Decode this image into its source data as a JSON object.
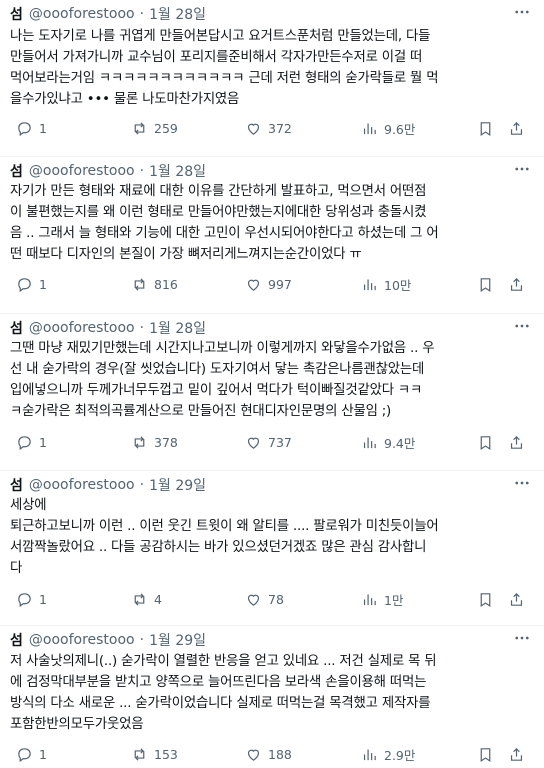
{
  "tweets": [
    {
      "name": "섬",
      "handle": "@oooforestooo",
      "date": "1월 28일",
      "text": "나는 도자기로 나를 귀엽게 만들어본답시고 요거트스푼처럼 만들었는데, 다들\n만들어서 가져가니까 교수님이 포리지를준비해서 각자가만든수저로 이걸 떠\n먹어보라는거임 ㅋㅋㅋㅋㅋㅋㅋㅋㅋㅋㅋㅋ 근데 저런 형태의 숟가락들로 뭘 먹\n을수가있냐고 ••• 물론 나도마찬가지였음",
      "replies": "1",
      "retweets": "259",
      "likes": "372",
      "views": "9.6만"
    },
    {
      "name": "섬",
      "handle": "@oooforestooo",
      "date": "1월 28일",
      "text": "자기가 만든 형태와 재료에 대한 이유를 간단하게 발표하고, 먹으면서 어떤점\n이 불편했는지를 왜 이런 형태로 만들어야만했는지에대한 당위성과 충돌시켰\n음 .. 그래서 늘 형태와 기능에 대한 고민이 우선시되어야한다고 하셨는데 그 어\n떤 때보다 디자인의 본질이 가장 뼈저리게느껴지는순간이었다 ㅠ",
      "replies": "1",
      "retweets": "816",
      "likes": "997",
      "views": "10만"
    },
    {
      "name": "섬",
      "handle": "@oooforestooo",
      "date": "1월 28일",
      "text": "그땐 마냥 재밌기만했는데 시간지나고보니까 이렇게까지 와닿을수가없음 .. 우\n선 내 숟가락의 경우(잘 씻었습니다) 도자기여서 닿는 촉감은나름괜찮았는데\n입에넣으니까 두께가너무두껍고 밑이 깊어서 먹다가 턱이빠질것같았다 ㅋㅋ\nㅋ숟가락은 최적의곡률계산으로 만들어진 현대디자인문명의 산물임 ;)",
      "replies": "1",
      "retweets": "378",
      "likes": "737",
      "views": "9.4만"
    },
    {
      "name": "섬",
      "handle": "@oooforestooo",
      "date": "1월 29일",
      "text": "세상에\n퇴근하고보니까 이런 .. 이런 웃긴 트윗이 왜 알티를 .... 팔로워가 미친듯이늘어\n서깜짝놀랐어요 .. 다들 공감하시는 바가 있으셨던거겠죠 많은 관심 감사합니\n다",
      "replies": "1",
      "retweets": "4",
      "likes": "78",
      "views": "1만"
    },
    {
      "name": "섬",
      "handle": "@oooforestooo",
      "date": "1월 29일",
      "text": "저 사술낫의제니(..) 숟가락이 열렬한 반응을 얻고 있네요 ... 저건 실제로 목 뒤\n에 검정막대부분을 받치고 양쪽으로 늘어뜨린다음 보라색 손을이용해 떠먹는\n방식의 다소 새로운 ... 숟가락이었습니다 실제로 떠먹는걸 목격했고 제작자를\n포함한반의모두가웃었음",
      "replies": "1",
      "retweets": "153",
      "likes": "188",
      "views": "2.9만"
    }
  ],
  "icons": {
    "reply": "reply-icon",
    "retweet": "retweet-icon",
    "like": "heart-icon",
    "views": "views-icon",
    "bookmark": "bookmark-icon",
    "share": "share-icon",
    "more": "more-icon"
  },
  "colors": {
    "text": "#0f1419",
    "secondary": "#536471",
    "divider": "#eff3f4"
  }
}
